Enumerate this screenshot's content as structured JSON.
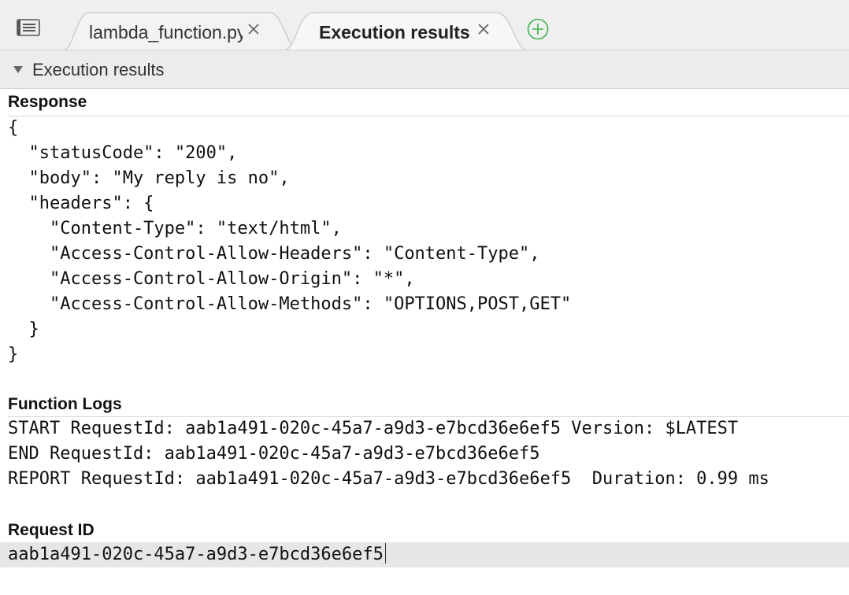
{
  "tabs": [
    {
      "label": "lambda_function.py",
      "active": false
    },
    {
      "label": "Execution results",
      "active": true
    }
  ],
  "section": {
    "title": "Execution results"
  },
  "response": {
    "title": "Response",
    "lines": [
      "{",
      "  \"statusCode\": \"200\",",
      "  \"body\": \"My reply is no\",",
      "  \"headers\": {",
      "    \"Content-Type\": \"text/html\",",
      "    \"Access-Control-Allow-Headers\": \"Content-Type\",",
      "    \"Access-Control-Allow-Origin\": \"*\",",
      "    \"Access-Control-Allow-Methods\": \"OPTIONS,POST,GET\"",
      "  }",
      "}"
    ]
  },
  "function_logs": {
    "title": "Function Logs",
    "lines": [
      "START RequestId: aab1a491-020c-45a7-a9d3-e7bcd36e6ef5 Version: $LATEST",
      "END RequestId: aab1a491-020c-45a7-a9d3-e7bcd36e6ef5",
      "REPORT RequestId: aab1a491-020c-45a7-a9d3-e7bcd36e6ef5  Duration: 0.99 ms"
    ]
  },
  "request": {
    "title": "Request ID",
    "id": "aab1a491-020c-45a7-a9d3-e7bcd36e6ef5"
  },
  "icons": {
    "menu": "list-menu-icon",
    "close": "close-icon",
    "add": "add-tab-icon",
    "caret": "caret-down-icon"
  },
  "colors": {
    "add_icon": "#3fb34f",
    "tab_active_bg": "#f7f7f7",
    "tab_inactive_bg": "#efefef"
  }
}
